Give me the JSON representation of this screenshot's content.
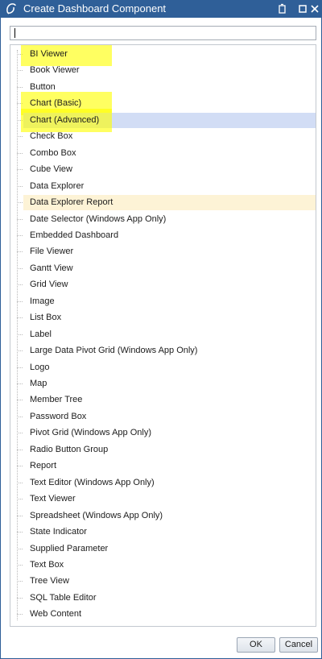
{
  "window": {
    "title": "Create Dashboard Component",
    "app_icon": "onestream-logo-icon"
  },
  "titlebar_buttons": [
    {
      "name": "restore-icon"
    },
    {
      "name": "maximize-icon"
    },
    {
      "name": "close-icon"
    }
  ],
  "search": {
    "value": "",
    "placeholder": ""
  },
  "components": {
    "items": [
      {
        "label": "BI Viewer",
        "highlight": true
      },
      {
        "label": "Book Viewer"
      },
      {
        "label": "Button"
      },
      {
        "label": "Chart (Basic)",
        "highlight": true
      },
      {
        "label": "Chart (Advanced)",
        "highlight": true,
        "selected": true
      },
      {
        "label": "Check Box"
      },
      {
        "label": "Combo Box"
      },
      {
        "label": "Cube View"
      },
      {
        "label": "Data Explorer"
      },
      {
        "label": "Data Explorer Report",
        "hovered": true
      },
      {
        "label": "Date Selector (Windows App Only)"
      },
      {
        "label": "Embedded Dashboard"
      },
      {
        "label": "File Viewer"
      },
      {
        "label": "Gantt View"
      },
      {
        "label": "Grid View"
      },
      {
        "label": "Image"
      },
      {
        "label": "List Box"
      },
      {
        "label": "Label"
      },
      {
        "label": "Large Data Pivot Grid (Windows App Only)"
      },
      {
        "label": "Logo"
      },
      {
        "label": "Map"
      },
      {
        "label": "Member Tree"
      },
      {
        "label": "Password Box"
      },
      {
        "label": "Pivot Grid (Windows App Only)"
      },
      {
        "label": "Radio Button Group"
      },
      {
        "label": "Report"
      },
      {
        "label": "Text Editor (Windows App Only)"
      },
      {
        "label": "Text Viewer"
      },
      {
        "label": "Spreadsheet (Windows App Only)"
      },
      {
        "label": "State Indicator"
      },
      {
        "label": "Supplied Parameter"
      },
      {
        "label": "Text Box"
      },
      {
        "label": "Tree View"
      },
      {
        "label": "SQL Table Editor"
      },
      {
        "label": "Web Content"
      }
    ]
  },
  "buttons": {
    "ok": "OK",
    "cancel": "Cancel"
  },
  "colors": {
    "titlebar": "#2f5f98",
    "selection": "#d2ddf5",
    "hover": "#fdf3d6",
    "annotation_highlight": "#ffff00"
  }
}
